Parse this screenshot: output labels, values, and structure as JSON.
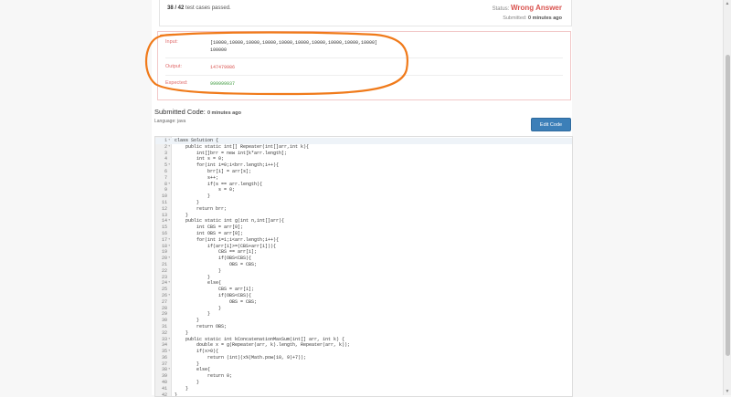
{
  "status": {
    "passed": "38 / 42",
    "passed_suffix": " test cases passed.",
    "status_label": "Status: ",
    "status_value": "Wrong Answer",
    "submitted_label": "Submitted: ",
    "submitted_value": "0 minutes ago"
  },
  "result": {
    "input_label": "Input:",
    "input_value_line1": "[10000,10000,10000,10000,10000,10000,10000,10000,10000,10000]",
    "input_value_line2": "100000",
    "output_label": "Output:",
    "output_value": "147479986",
    "expected_label": "Expected:",
    "expected_value": "999999937",
    "annotation_color": "#f07a1a"
  },
  "submission": {
    "title": "Submitted Code: ",
    "time": "0 minutes ago",
    "language_label": "Language: ",
    "language": "java",
    "edit_button": "Edit Code"
  },
  "code": [
    "class Solution {",
    "    public static int[] Repeater(int[]arr,int k){",
    "        int[]brr = new int[k*arr.length];",
    "        int s = 0;",
    "        for(int i=0;i<brr.length;i++){",
    "            brr[i] = arr[s];",
    "            s++;",
    "            if(s == arr.length){",
    "                s = 0;",
    "            }",
    "        }",
    "        return brr;",
    "    }",
    "    public static int g(int n,int[]arr){",
    "        int CBS = arr[0];",
    "        int OBS = arr[0];",
    "        for(int i=1;i<arr.length;i++){",
    "            if(arr[i]>=(CBS+arr[i])){",
    "                CBS == arr[i];",
    "                if(OBS<CBS){",
    "                    OBS = CBS;",
    "                }",
    "            }",
    "            else{",
    "                CBS = arr[i];",
    "                if(OBS<CBS){",
    "                    OBS = CBS;",
    "                }",
    "            }",
    "        }",
    "        return OBS;",
    "    }",
    "    public static int kConcatenationMaxSum(int[] arr, int k) {",
    "        double x = g(Repeater(arr, k).length, Repeater(arr, k));",
    "        if(x>0){",
    "            return (int)(x%(Math.pow(10, 9)+7));",
    "        }",
    "        else{",
    "            return 0;",
    "        }",
    "    }",
    "}"
  ],
  "folds": [
    1,
    2,
    5,
    8,
    14,
    17,
    18,
    20,
    24,
    26,
    33,
    35,
    38
  ]
}
